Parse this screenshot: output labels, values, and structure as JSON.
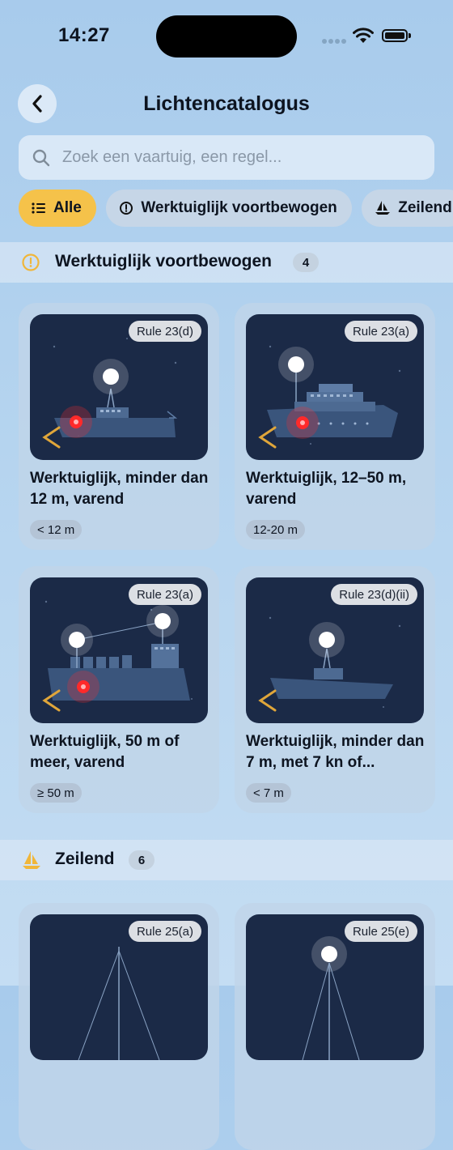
{
  "status_bar": {
    "time": "14:27"
  },
  "header": {
    "title": "Lichtencatalogus"
  },
  "search": {
    "placeholder": "Zoek een vaartuig, een regel..."
  },
  "filters": [
    {
      "label": "Alle",
      "icon": "list-icon",
      "active": true
    },
    {
      "label": "Werktuiglijk voortbewogen",
      "icon": "gauge-icon",
      "active": false
    },
    {
      "label": "Zeilend",
      "icon": "sailboat-icon",
      "active": false
    }
  ],
  "sections": [
    {
      "title": "Werktuiglijk voortbewogen",
      "count": "4",
      "icon": "gauge-icon",
      "cards": [
        {
          "rule": "Rule 23(d)",
          "title": "Werktuiglijk, minder dan 12 m, varend",
          "size": "< 12 m"
        },
        {
          "rule": "Rule 23(a)",
          "title": "Werktuiglijk, 12–50 m, varend",
          "size": "12-20 m"
        },
        {
          "rule": "Rule 23(a)",
          "title": "Werktuiglijk, 50 m of meer, varend",
          "size": "≥ 50 m"
        },
        {
          "rule": "Rule 23(d)(ii)",
          "title": "Werktuiglijk, minder dan 7 m, met 7 kn of...",
          "size": "< 7 m"
        }
      ]
    },
    {
      "title": "Zeilend",
      "count": "6",
      "icon": "sailboat-icon",
      "cards": [
        {
          "rule": "Rule 25(a)"
        },
        {
          "rule": "Rule 25(e)"
        }
      ]
    }
  ],
  "colors": {
    "accent": "#f5c24a",
    "night_thumb": "#1b2a47",
    "port_light": "#ff2a2a",
    "masthead_light": "#ffffff"
  }
}
